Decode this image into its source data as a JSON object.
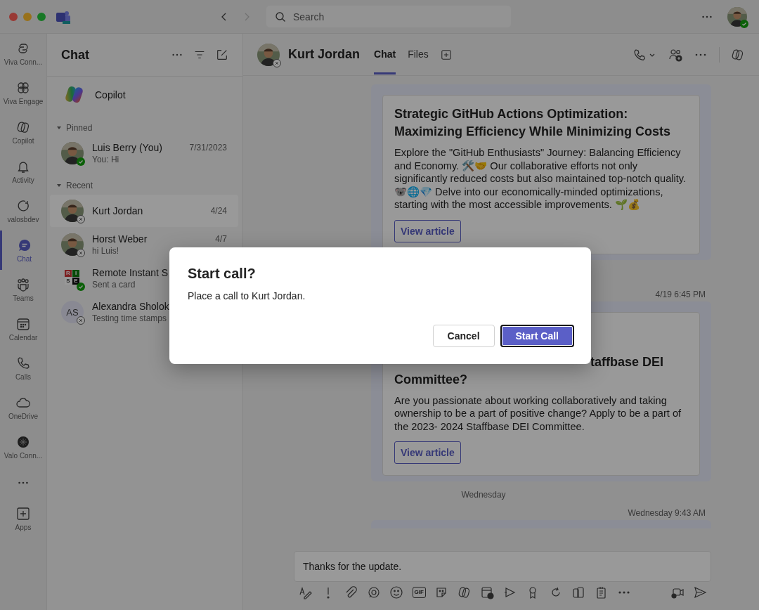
{
  "titlebar": {
    "search": {
      "placeholder": "Search"
    }
  },
  "rail": {
    "items": [
      {
        "label": "Viva Conn...",
        "selected": false
      },
      {
        "label": "Viva Engage",
        "selected": false
      },
      {
        "label": "Copilot",
        "selected": false
      },
      {
        "label": "Activity",
        "selected": false
      },
      {
        "label": "valosbdev",
        "selected": false
      },
      {
        "label": "Chat",
        "selected": true
      },
      {
        "label": "Teams",
        "selected": false
      },
      {
        "label": "Calendar",
        "selected": false
      },
      {
        "label": "Calls",
        "selected": false
      },
      {
        "label": "OneDrive",
        "selected": false
      },
      {
        "label": "Valo Conn...",
        "selected": false
      }
    ],
    "apps_label": "Apps"
  },
  "chat_list": {
    "title": "Chat",
    "copilot": "Copilot",
    "sections": [
      {
        "label": "Pinned",
        "expanded": true,
        "items": [
          {
            "name": "Luis Berry (You)",
            "preview": "You: Hi",
            "date": "7/31/2023",
            "selected": false,
            "available": true
          }
        ]
      },
      {
        "label": "Recent",
        "expanded": true,
        "items": [
          {
            "name": "Kurt Jordan",
            "date": "4/24",
            "selected": true,
            "available": false
          },
          {
            "name": "Horst Weber",
            "preview": "hi Luis!",
            "date": "4/7",
            "selected": false,
            "available": false
          },
          {
            "name": "Remote Instant S",
            "preview": "Sent a card",
            "selected": false,
            "available": true,
            "avatar": {
              "kind": "logo",
              "letters": [
                "R",
                "I",
                "S",
                "E"
              ]
            }
          },
          {
            "name": "Alexandra Sholok",
            "preview": "Testing time stamps",
            "selected": false,
            "available": false,
            "avatar": {
              "kind": "initials",
              "initials": "AS"
            }
          }
        ]
      }
    ]
  },
  "conversation": {
    "name": "Kurt Jordan",
    "available": false,
    "tabs": [
      {
        "label": "Chat",
        "selected": true
      },
      {
        "label": "Files",
        "selected": false
      }
    ],
    "messages": [
      {
        "kind": "card",
        "title_lines": [
          "Strategic GitHub Actions Optimization:",
          "Maximizing Efficiency While Minimizing Costs"
        ],
        "body": "Explore the \"GitHub Enthusiasts\" Journey: Balancing Efficiency and Economy. 🛠️🤝 Our collaborative efforts not only significantly reduced costs but also maintained top-notch quality. 🐨🌐💎 Delve into our economically-minded optimizations, starting with the most accessible improvements. 🌱💰",
        "button": "View article"
      },
      {
        "kind": "timestamp",
        "text": "4/19 6:45 PM"
      },
      {
        "kind": "covered_card",
        "title_lines": [
          "taffbase DEI",
          "Committee?"
        ],
        "body": "Are you passionate about working collaboratively and taking ownership to be a part of positive change? Apply to be a part of the 2023- 2024 Staffbase DEI Committee.",
        "button": "View article"
      },
      {
        "kind": "day",
        "text": "Wednesday"
      },
      {
        "kind": "timestamp",
        "text": "Wednesday 9:43 AM"
      },
      {
        "kind": "stub"
      }
    ],
    "compose": {
      "value": "Thanks for the update.",
      "gif_label": "GIF"
    }
  },
  "dialog": {
    "title": "Start call?",
    "message": "Place a call to Kurt Jordan.",
    "buttons": [
      {
        "label": "Cancel",
        "primary": false
      },
      {
        "label": "Start Call",
        "primary": true
      }
    ]
  }
}
